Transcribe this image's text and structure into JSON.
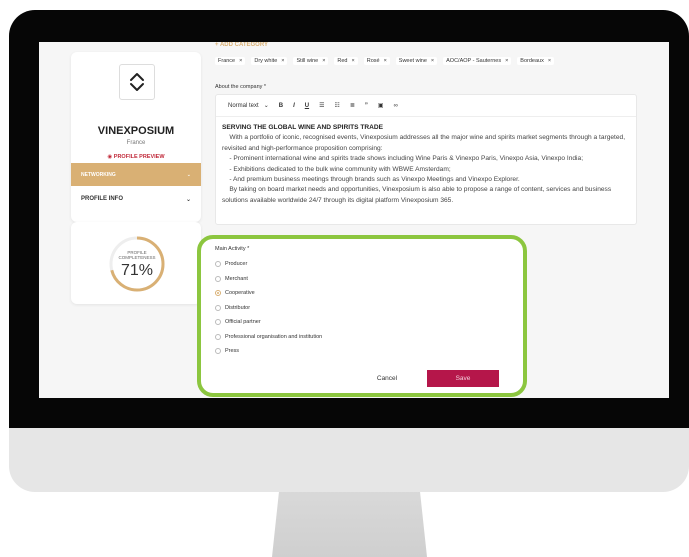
{
  "company": {
    "name": "VINEXPOSIUM",
    "country": "France",
    "preview_label": "PROFILE PREVIEW"
  },
  "sidebar": {
    "items": [
      {
        "label": "NETWORKING",
        "active": true
      },
      {
        "label": "PROFILE INFO",
        "active": false
      }
    ]
  },
  "completeness": {
    "label_line1": "PROFILE",
    "label_line2": "COMPLETENESS",
    "value_text": "71%",
    "value": 0.71
  },
  "form": {
    "add_category": "+ ADD CATEGORY",
    "tags": [
      "France",
      "Dry white",
      "Still wine",
      "Red",
      "Rosé",
      "Sweet wine",
      "AOC/AOP - Sauternes",
      "Bordeaux"
    ],
    "tag_remove": "×",
    "about_label": "About the company *",
    "toolbar": {
      "text_style": "Normal text",
      "bold": "B",
      "italic": "I",
      "underline": "U",
      "bullet_list": "☰",
      "numbered_list": "☷",
      "align": "≣",
      "quote": "”",
      "image": "▣",
      "link": "∞"
    },
    "about": {
      "heading": "SERVING THE GLOBAL WINE AND SPIRITS TRADE",
      "paragraph1": "    With a portfolio of iconic, recognised events, Vinexposium addresses all the major wine and spirits market segments through a targeted, revisited and high-performance proposition comprising:",
      "bullet1": "    - Prominent international wine and spirits trade shows including Wine Paris & Vinexpo Paris, Vinexpo Asia, Vinexpo India;",
      "bullet2": "    - Exhibitions dedicated to the bulk wine community with WBWE Amsterdam;",
      "bullet3": "    - And premium business meetings through brands such as Vinexpo Meetings and Vinexpo Explorer.",
      "paragraph2": "    By taking on board market needs and opportunities, Vinexposium is also able to propose a range of content, services and business solutions available worldwide 24/7 through its digital platform Vinexposium 365."
    },
    "main_activity": {
      "label": "Main Activity *",
      "options": [
        "Producer",
        "Merchant",
        "Cooperative",
        "Distributor",
        "Official partner",
        "Professional organisation and institution",
        "Press"
      ],
      "selected": "Cooperative"
    },
    "cancel_label": "Cancel",
    "save_label": "Save"
  },
  "colors": {
    "accent_gold": "#d9b074",
    "save_button": "#b5164a",
    "highlight_green": "#8cc63f",
    "preview_red": "#c12a3a"
  },
  "icons": [
    "vinexposium-logo-icon",
    "eye-icon",
    "chevron-down-icon",
    "bold-icon",
    "italic-icon",
    "underline-icon",
    "bullet-list-icon",
    "numbered-list-icon",
    "align-icon",
    "quote-icon",
    "camera-icon",
    "link-icon"
  ]
}
